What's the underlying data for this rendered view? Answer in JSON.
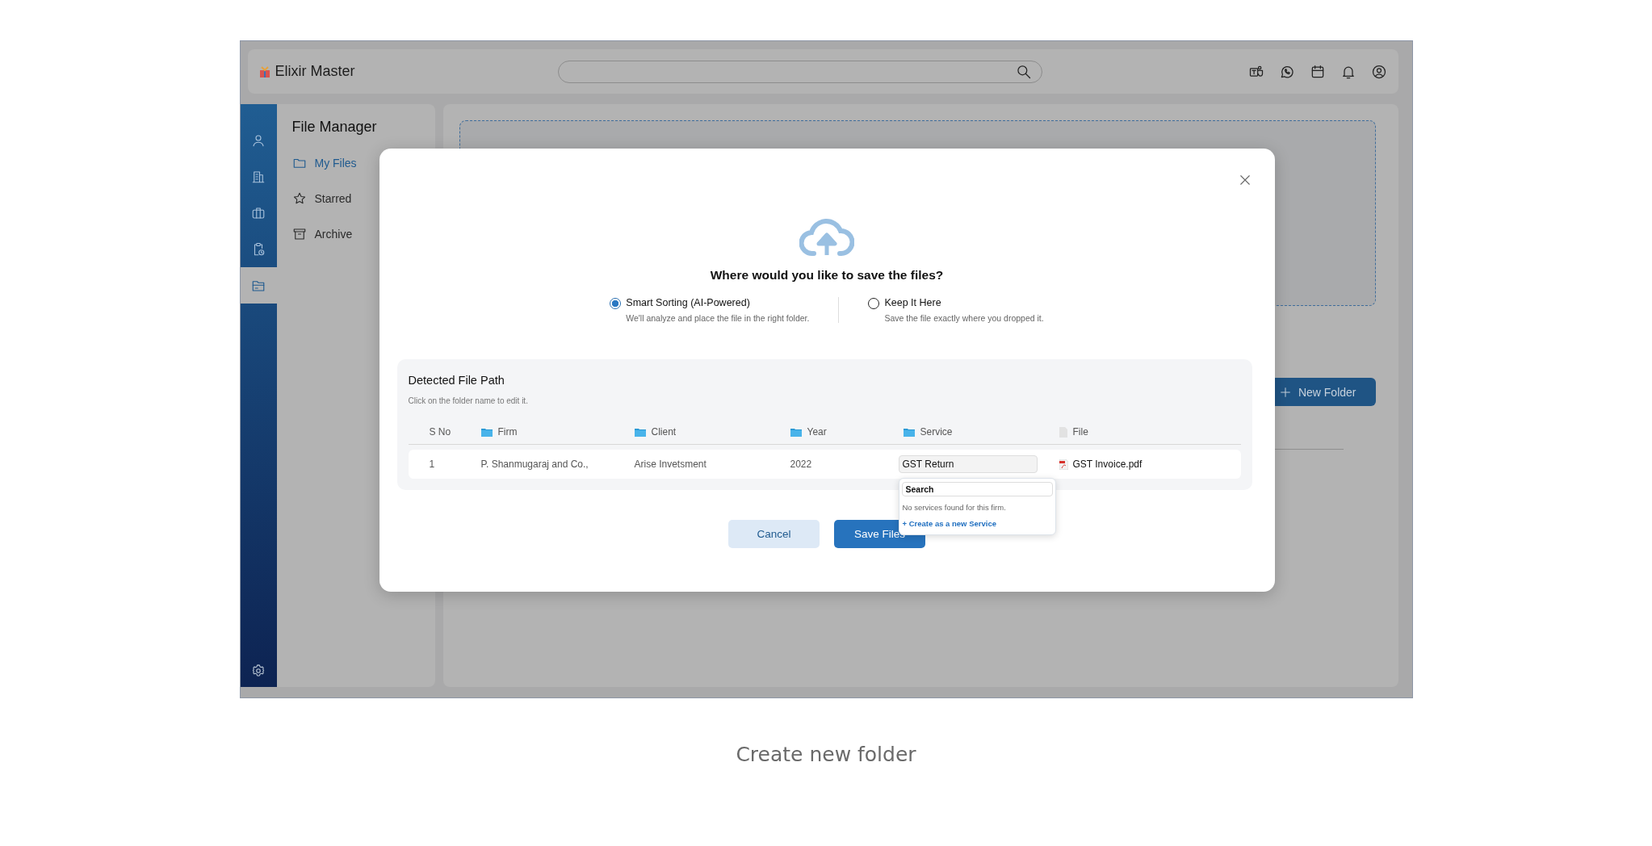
{
  "app": {
    "title": "Elixir Master"
  },
  "header_icons": [
    {
      "kind": "teams"
    },
    {
      "kind": "chat"
    },
    {
      "kind": "calendar"
    },
    {
      "kind": "bell"
    },
    {
      "kind": "account"
    }
  ],
  "rail": [
    {
      "kind": "person",
      "selected": false
    },
    {
      "kind": "building",
      "selected": false
    },
    {
      "kind": "briefcase",
      "selected": false
    },
    {
      "kind": "clipboard-clock",
      "selected": false
    },
    {
      "kind": "file-drawer",
      "selected": true
    }
  ],
  "file_manager": {
    "title": "File Manager",
    "items": [
      {
        "label": "My Files",
        "kind": "folder",
        "selected": true
      },
      {
        "label": "Starred",
        "kind": "star",
        "selected": false
      },
      {
        "label": "Archive",
        "kind": "archive",
        "selected": false
      }
    ]
  },
  "main": {
    "new_folder_button": "New Folder"
  },
  "modal": {
    "question": "Where would you like to save the files?",
    "options": [
      {
        "label": "Smart Sorting (AI-Powered)",
        "description": "We'll analyze and place the file in the right folder.",
        "selected": true
      },
      {
        "label": "Keep It Here",
        "description": "Save the file exactly where you dropped it.",
        "selected": false
      }
    ],
    "detected": {
      "title": "Detected File Path",
      "hint": "Click on the folder name to edit it.",
      "columns": [
        {
          "label": "S No",
          "kind": "plain"
        },
        {
          "label": "Firm",
          "kind": "folder"
        },
        {
          "label": "Client",
          "kind": "folder"
        },
        {
          "label": "Year",
          "kind": "folder"
        },
        {
          "label": "Service",
          "kind": "folder"
        },
        {
          "label": "File",
          "kind": "file"
        }
      ],
      "rows": [
        {
          "sno": "1",
          "firm": "P. Shanmugaraj and Co.,",
          "client": "Arise Invetsment",
          "year": "2022",
          "service": "GST Return",
          "file": "GST Invoice.pdf"
        }
      ]
    },
    "service_dropdown": {
      "search_value": "Search",
      "empty_message": "No services found for this firm.",
      "create_link": "+ Create as a new Service"
    },
    "buttons": [
      {
        "label": "Cancel",
        "kind": "secondary"
      },
      {
        "label": "Save Files",
        "kind": "primary"
      }
    ]
  },
  "caption": "Create new folder"
}
